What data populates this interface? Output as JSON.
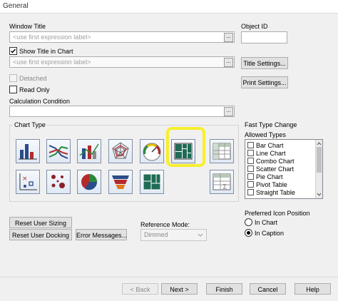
{
  "window": {
    "title": "General"
  },
  "window_title": {
    "label": "Window Title",
    "placeholder": "<use first expression label>"
  },
  "object_id": {
    "label": "Object ID",
    "value": ""
  },
  "show_title": {
    "label": "Show Title in Chart",
    "checked": true,
    "placeholder": "<use first expression label>"
  },
  "buttons": {
    "title_settings": "Title Settings...",
    "print_settings": "Print Settings...",
    "reset_user_sizing": "Reset User Sizing",
    "reset_user_docking": "Reset User Docking",
    "error_messages": "Error Messages...",
    "back": "< Back",
    "next": "Next >",
    "finish": "Finish",
    "cancel": "Cancel",
    "help": "Help"
  },
  "detached": {
    "label": "Detached",
    "checked": false
  },
  "read_only": {
    "label": "Read Only",
    "checked": false
  },
  "calc_condition": {
    "label": "Calculation Condition",
    "value": ""
  },
  "chart_type": {
    "label": "Chart Type",
    "icons": [
      "bar-chart-icon",
      "line-chart-icon",
      "combo-chart-icon",
      "radar-chart-icon",
      "gauge-chart-icon",
      "mekko-chart-icon",
      "pivot-table-icon",
      "scatter-chart-icon",
      "grid-chart-icon",
      "pie-chart-icon",
      "funnel-chart-icon",
      "block-chart-icon",
      "straight-table-icon"
    ],
    "selected": "mekko-chart-icon",
    "highlight_color": "#f7ee2e"
  },
  "fast_type_change": {
    "label": "Fast Type Change",
    "allowed_types_label": "Allowed Types",
    "items": [
      "Bar Chart",
      "Line Chart",
      "Combo Chart",
      "Scatter Chart",
      "Pie Chart",
      "Pivot Table",
      "Straight Table"
    ]
  },
  "reference_mode": {
    "label": "Reference Mode:",
    "value": "Dimmed"
  },
  "icon_position": {
    "label": "Preferred Icon Position",
    "options": [
      "In Chart",
      "In Caption"
    ],
    "selected": "In Caption"
  }
}
